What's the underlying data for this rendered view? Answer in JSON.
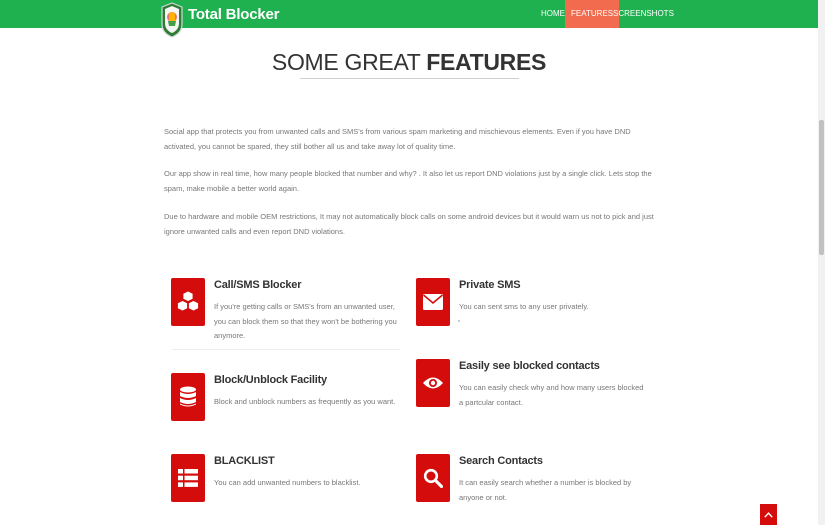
{
  "navbar": {
    "brand": "Total Blocker",
    "items": [
      {
        "label": "HOME"
      },
      {
        "label": "FEATURES"
      },
      {
        "label": "SCREENSHOTS"
      }
    ],
    "active_color": "#f26b4e",
    "bg_color": "#1fb04f"
  },
  "section": {
    "title_light": "SOME GREAT",
    "title_bold": "FEATURES",
    "paragraphs": [
      "Social app that protects you from unwanted calls and SMS's from various spam marketing and mischievous elements. Even if you have DND activated, you cannot be spared, they still bother all us and take away lot of quality time.",
      "Our app show in real time, how many people blocked that number and why? . It also let us report DND violations just by a single click. Lets stop the spam, make mobile a better world again.",
      "Due to hardware and mobile OEM restrictions, It may not automatically block calls on some android devices but it would warn us not to pick and just ignore unwanted calls and even report DND violations."
    ]
  },
  "features": [
    {
      "title": "Call/SMS Blocker",
      "desc": "If you're getting calls or SMS's from an unwanted user, you can block them so that they won't be bothering you anymore.",
      "icon": "cubes-icon"
    },
    {
      "title": "Private SMS",
      "desc": "You can sent sms to any user privately.",
      "icon": "envelope-icon"
    },
    {
      "title": "Block/Unblock Facility",
      "desc": "Block and unblock numbers as frequently as you want.",
      "icon": "database-icon"
    },
    {
      "title": "Easily see blocked contacts",
      "desc": "You can easily check why and how many users blocked a partcular contact.",
      "icon": "eye-icon"
    },
    {
      "title": "BLACKLIST",
      "desc": "You can add unwanted numbers to blacklist.",
      "icon": "list-icon"
    },
    {
      "title": "Search Contacts",
      "desc": "It can easily search whether a number is blocked by anyone or not.",
      "icon": "search-icon"
    }
  ],
  "accent_color": "#d40c0c"
}
